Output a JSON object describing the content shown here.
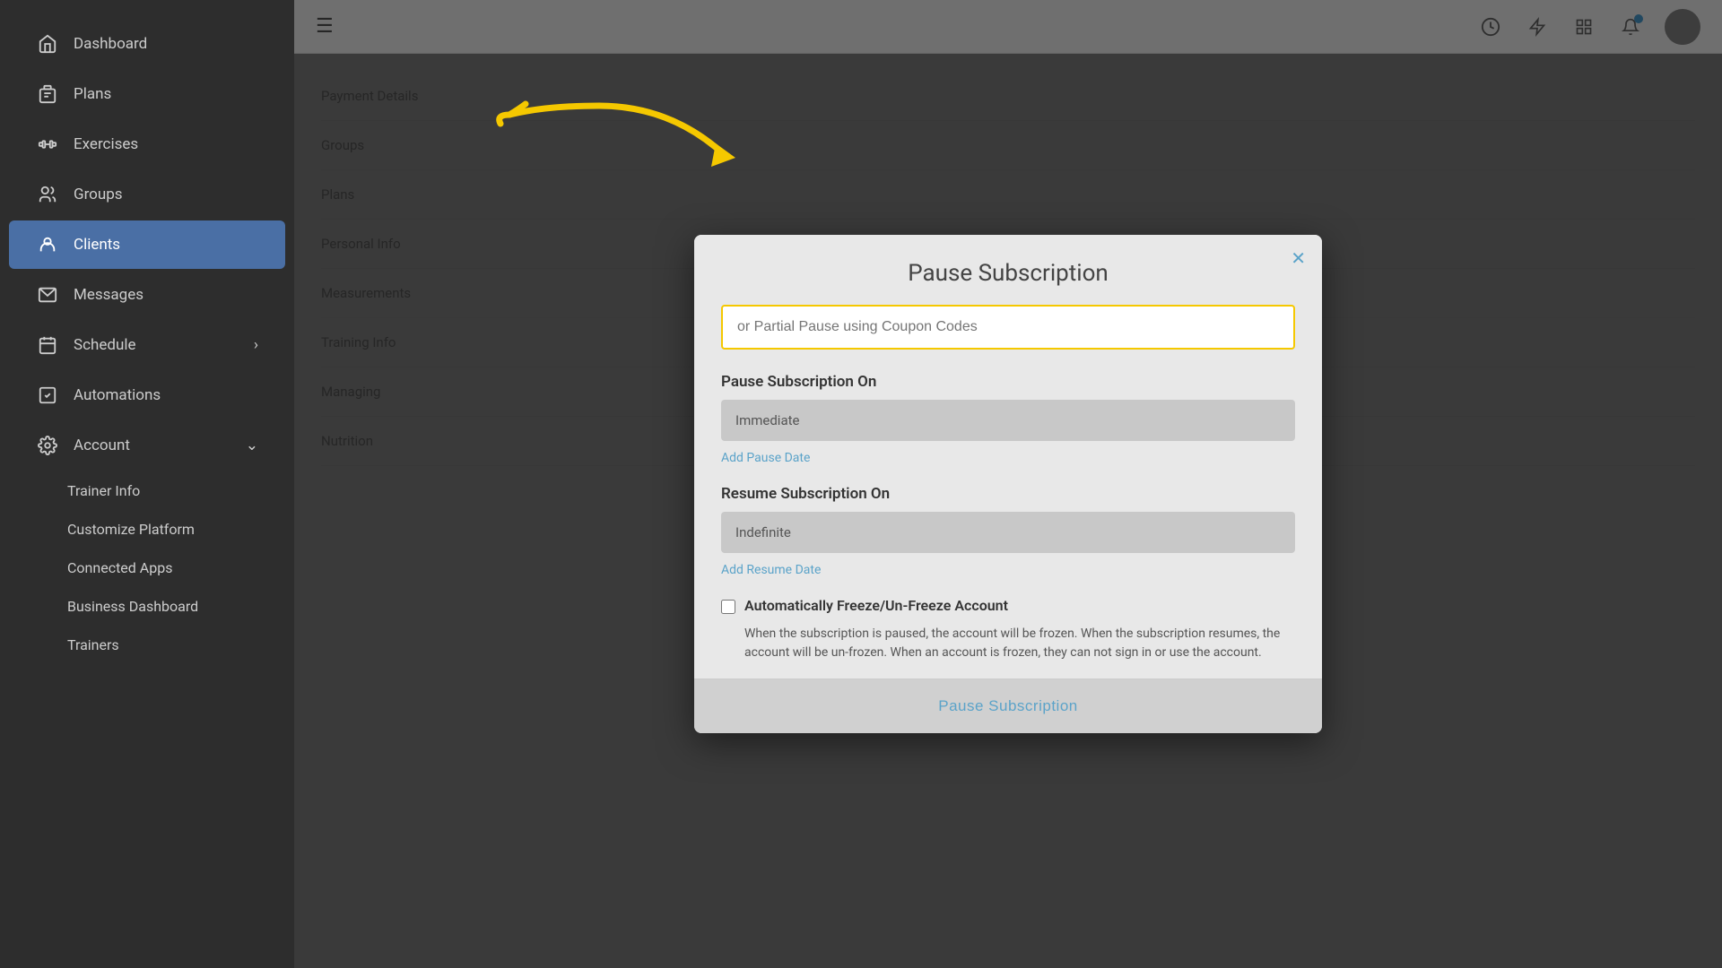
{
  "sidebar": {
    "items": [
      {
        "id": "dashboard",
        "label": "Dashboard",
        "icon": "home"
      },
      {
        "id": "plans",
        "label": "Plans",
        "icon": "clipboard"
      },
      {
        "id": "exercises",
        "label": "Exercises",
        "icon": "dumbbell"
      },
      {
        "id": "groups",
        "label": "Groups",
        "icon": "users"
      },
      {
        "id": "clients",
        "label": "Clients",
        "icon": "person",
        "active": true
      },
      {
        "id": "messages",
        "label": "Messages",
        "icon": "mail"
      },
      {
        "id": "schedule",
        "label": "Schedule",
        "icon": "calendar",
        "hasChevron": true
      },
      {
        "id": "automations",
        "label": "Automations",
        "icon": "checkbox"
      },
      {
        "id": "account",
        "label": "Account",
        "icon": "gear",
        "hasChevron": true,
        "expanded": true
      }
    ],
    "sub_items": [
      {
        "id": "trainer-info",
        "label": "Trainer Info"
      },
      {
        "id": "customize-platform",
        "label": "Customize Platform"
      },
      {
        "id": "connected-apps",
        "label": "Connected Apps"
      },
      {
        "id": "business-dashboard",
        "label": "Business Dashboard"
      },
      {
        "id": "trainers",
        "label": "Trainers"
      }
    ]
  },
  "topbar": {
    "menu_icon": "☰",
    "icons": [
      "history",
      "lightning",
      "grid",
      "bell"
    ],
    "bell_badge": true
  },
  "bg_rows": [
    {
      "label": "Payment Details"
    },
    {
      "label": "Groups"
    },
    {
      "label": "Plans"
    },
    {
      "label": "Personal Info"
    },
    {
      "label": "Measurements"
    },
    {
      "label": "Training Info"
    },
    {
      "label": "Managing"
    },
    {
      "label": "Nutrition"
    }
  ],
  "modal": {
    "title": "Pause Subscription",
    "close_label": "✕",
    "coupon_placeholder": "or Partial Pause using Coupon Codes",
    "pause_on_label": "Pause Subscription On",
    "pause_on_value": "Immediate",
    "add_pause_date_label": "Add Pause Date",
    "resume_on_label": "Resume Subscription On",
    "resume_on_value": "Indefinite",
    "add_resume_date_label": "Add Resume Date",
    "freeze_label": "Automatically Freeze/Un-Freeze Account",
    "freeze_desc": "When the subscription is paused, the account will be frozen. When the subscription resumes, the account will be un-frozen. When an account is frozen, they can not sign in or use the account.",
    "submit_label": "Pause Subscription"
  }
}
